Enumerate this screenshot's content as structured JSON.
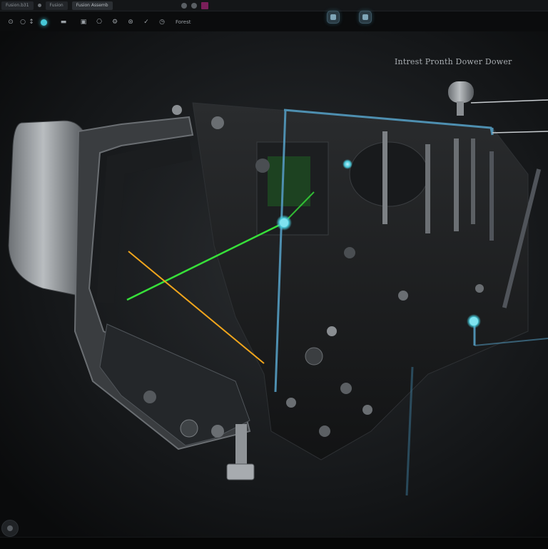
{
  "tabs": [
    {
      "label": "Fusion.b31",
      "active": false
    },
    {
      "label": "Fusion",
      "active": false
    },
    {
      "label": "Fusion Assemb",
      "active": true
    }
  ],
  "toolbar": {
    "tools": [
      {
        "icon": "select-icon",
        "glyph": "⊙"
      },
      {
        "icon": "orbit-icon",
        "glyph": "○"
      },
      {
        "icon": "pan-icon",
        "glyph": "↕"
      },
      {
        "icon": "active-tool-icon",
        "glyph": "",
        "active": true
      },
      {
        "icon": "measure-icon",
        "glyph": "▬"
      },
      {
        "icon": "section-icon",
        "glyph": "▣"
      },
      {
        "icon": "link-icon",
        "glyph": "⎔"
      },
      {
        "icon": "settings-icon",
        "glyph": "⚙"
      },
      {
        "icon": "joint-icon",
        "glyph": "⊛"
      },
      {
        "icon": "check-icon",
        "glyph": "✓"
      },
      {
        "icon": "timer-icon",
        "glyph": "◷"
      }
    ],
    "label": "Forest"
  },
  "annotation": "Intrest Pronth Dower Dower",
  "colors": {
    "accent": "#47c8d8",
    "laser_green": "#37e03a",
    "laser_orange": "#f0a51c",
    "outline_blue": "#4e8fb0",
    "magenta": "#7a1f5a"
  }
}
